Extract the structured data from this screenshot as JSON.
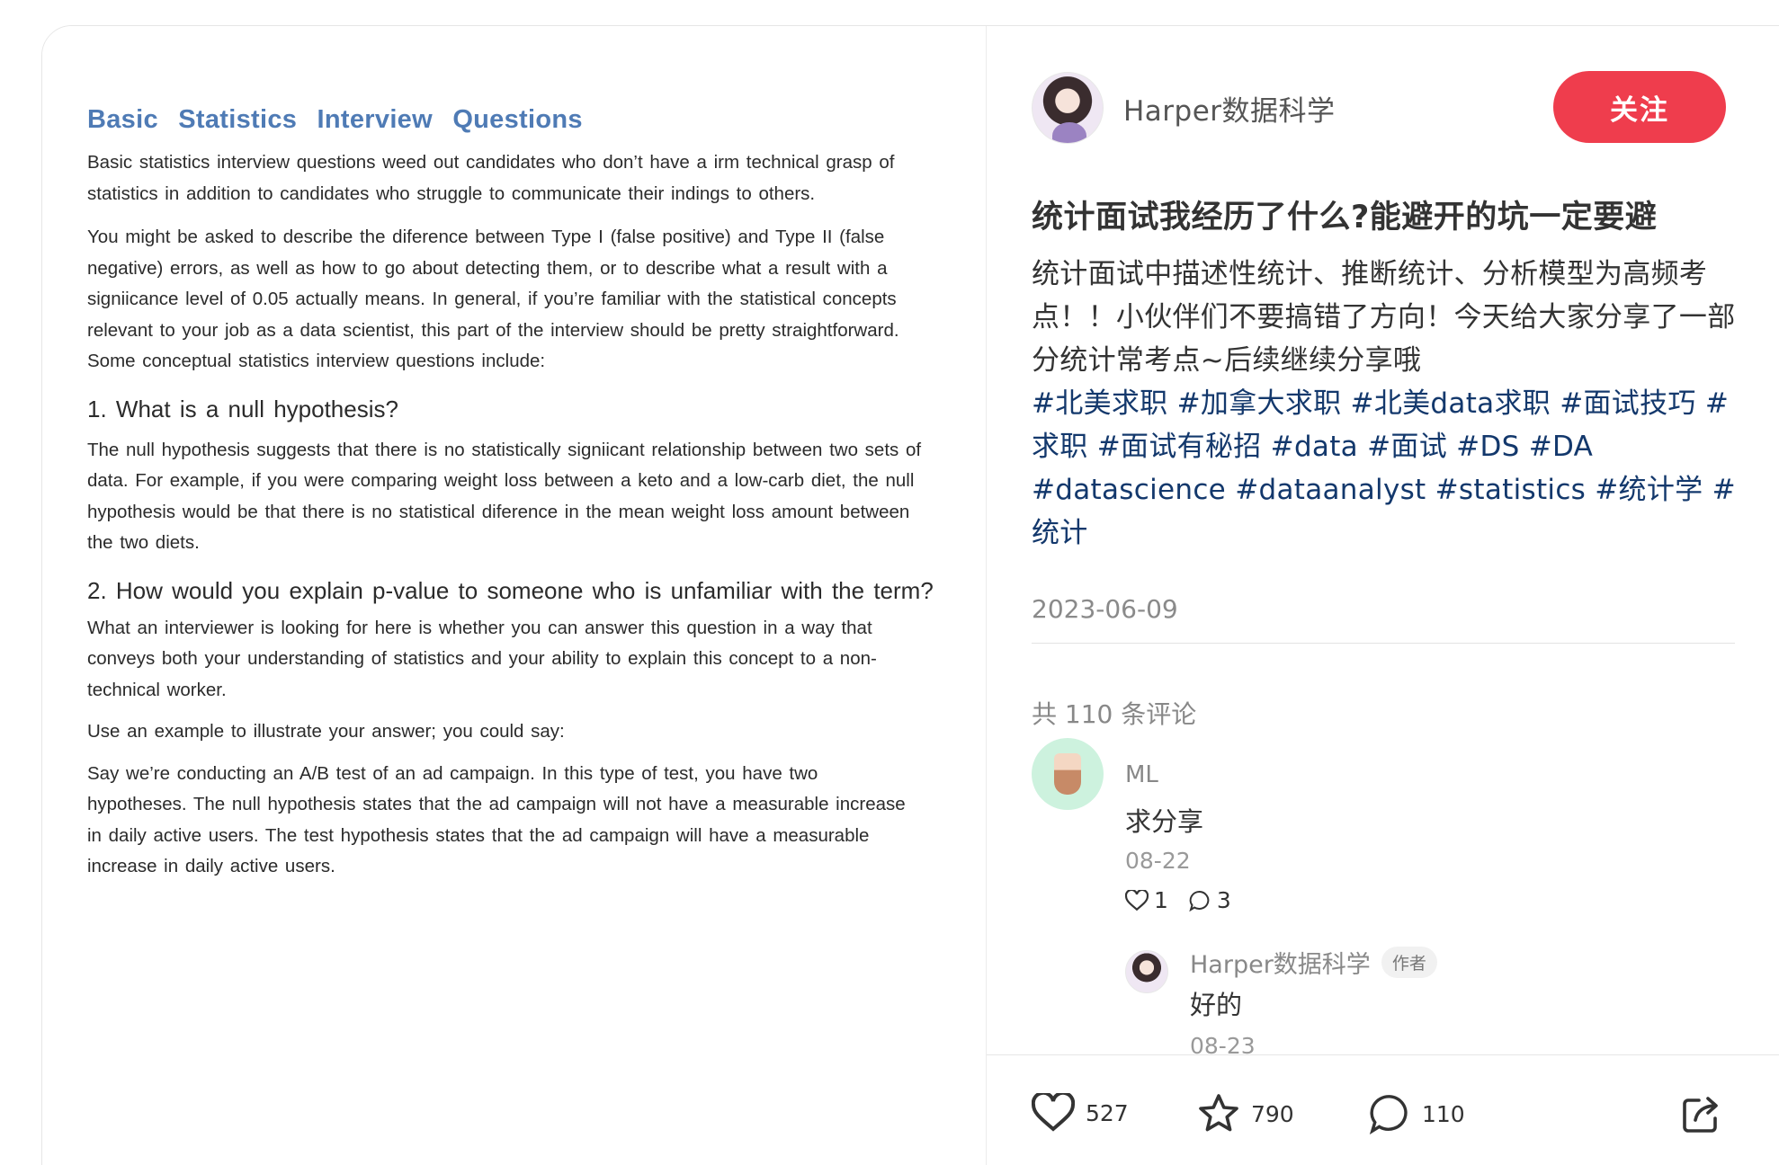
{
  "document": {
    "title": "Basic Statistics Interview Questions",
    "paragraph1": "Basic statistics interview questions weed out candidates who don’t have a irm technical grasp of statistics in addition to candidates who struggle to communicate their indings to others.",
    "paragraph2": "You might be asked to describe the diference between Type I (false positive) and Type II (false negative) errors, as well as how to go about detecting them, or to describe what a result with a signiicance level of 0.05 actually means. In general, if you’re familiar with the statistical concepts relevant to your job as a data scientist, this part of the interview should be pretty straightforward. Some conceptual statistics interview questions include:",
    "q1_heading": "1. What is a null hypothesis?",
    "q1_answer": "The null hypothesis suggests that there is no statistically signiicant relationship between two sets of data. For example, if you were comparing weight loss between a keto and a low-carb diet, the null hypothesis would be that there is no statistical diference in the mean weight loss amount between the two diets.",
    "q2_heading": "2. How would you explain p-value to someone who is unfamiliar with the term?",
    "q2_answer": "What an interviewer is looking for here is whether you can answer this question in a way that conveys both your understanding of statistics and your ability to explain this concept to a non-technical worker.",
    "q2_example_intro": "Use an example to illustrate your answer; you could say:",
    "q2_example": "Say we’re conducting an A/B test of an ad campaign. In this type of test, you have two hypotheses. The null hypothesis states that the ad campaign will not have a measurable increase in daily active users. The test hypothesis states that the ad campaign will have a measurable increase in daily active users."
  },
  "author": {
    "name": "Harper数据科学",
    "follow_label": "关注"
  },
  "note": {
    "title": "统计面试我经历了什么?能避开的坑一定要避",
    "body": "统计面试中描述性统计、推断统计、分析模型为高频考点！！小伙伴们不要搞错了方向！今天给大家分享了一部分统计常考点~后续继续分享哦",
    "tags": "#北美求职 #加拿大求职 #北美data求职 #面试技巧 #求职 #面试有秘招 #data #面试 #DS #DA #datascience #dataanalyst #statistics #统计学 #统计",
    "date": "2023-06-09"
  },
  "comments": {
    "count_label": "共 110 条评论",
    "items": [
      {
        "user": "ML",
        "text": "求分享",
        "date": "08-22",
        "likes": "1",
        "replies": "3",
        "reply": {
          "user": "Harper数据科学",
          "badge": "作者",
          "text": "好的",
          "date": "08-23"
        }
      }
    ]
  },
  "bottom_bar": {
    "likes": "527",
    "collects": "790",
    "comments": "110"
  },
  "colors": {
    "accent": "#ef3d4d",
    "tag": "#13386c",
    "doc_title": "#4f7bb5"
  }
}
